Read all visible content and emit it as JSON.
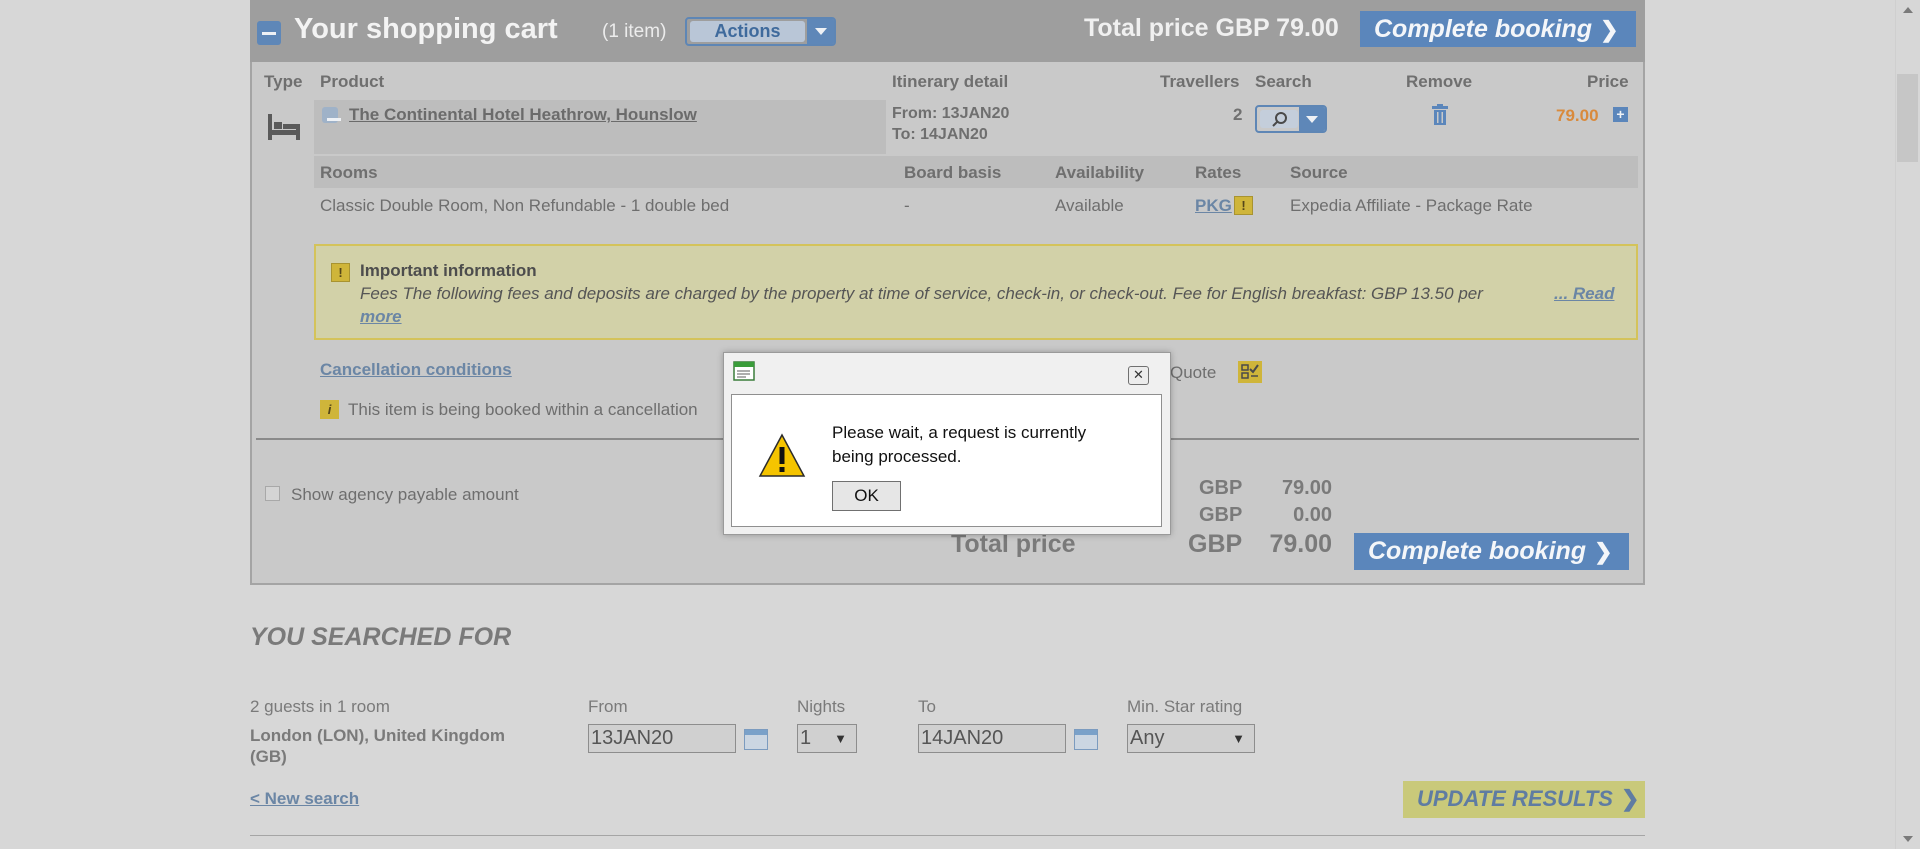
{
  "cart": {
    "title": "Your shopping cart",
    "item_count": "(1 item)",
    "actions_label": "Actions",
    "total_label": "Total price",
    "total_value": "GBP 79.00",
    "complete_booking": "Complete booking",
    "columns": {
      "type": "Type",
      "product": "Product",
      "itinerary": "Itinerary detail",
      "travellers": "Travellers",
      "search": "Search",
      "remove": "Remove",
      "price": "Price"
    },
    "item": {
      "product_name": "The Continental Hotel Heathrow, Hounslow",
      "from": "From: 13JAN20",
      "to": "To: 14JAN20",
      "travellers": "2",
      "price": "79.00"
    },
    "room_columns": {
      "rooms": "Rooms",
      "board": "Board basis",
      "availability": "Availability",
      "rates": "Rates",
      "source": "Source"
    },
    "room": {
      "name": "Classic Double Room, Non Refundable - 1 double bed",
      "board": "-",
      "availability": "Available",
      "rate": "PKG",
      "source": "Expedia Affiliate - Package Rate"
    },
    "important": {
      "title": "Important information",
      "text": "Fees The following fees and deposits are charged by the property at time of service, check-in, or check-out. Fee for English breakfast: GBP 13.50 per",
      "read_more_1": "... Read",
      "read_more_2": "more"
    },
    "cancellation_link": "Cancellation conditions",
    "quote_label": "Quote",
    "cancellation_note": "This item is being booked within a cancellation",
    "show_agency": "Show agency payable amount",
    "summary": {
      "row1_currency": "GBP",
      "row1_value": "79.00",
      "row2_currency": "GBP",
      "row2_value": "0.00",
      "total_label": "Total price",
      "total_currency": "GBP",
      "total_value": "79.00"
    }
  },
  "search": {
    "title": "YOU SEARCHED FOR",
    "guests": "2 guests in 1 room",
    "location": "London (LON), United Kingdom (GB)",
    "from_label": "From",
    "from_value": "13JAN20",
    "nights_label": "Nights",
    "nights_value": "1",
    "to_label": "To",
    "to_value": "14JAN20",
    "star_label": "Min. Star rating",
    "star_value": "Any",
    "new_search": "< New search",
    "update_results": "UPDATE RESULTS"
  },
  "dialog": {
    "message_line1": "Please wait, a request is currently",
    "message_line2": "being processed.",
    "ok": "OK",
    "close": "✕"
  },
  "colors": {
    "accent_blue": "#5b86bb",
    "price_orange": "#d98a3c",
    "update_button": "#c9c97a"
  }
}
